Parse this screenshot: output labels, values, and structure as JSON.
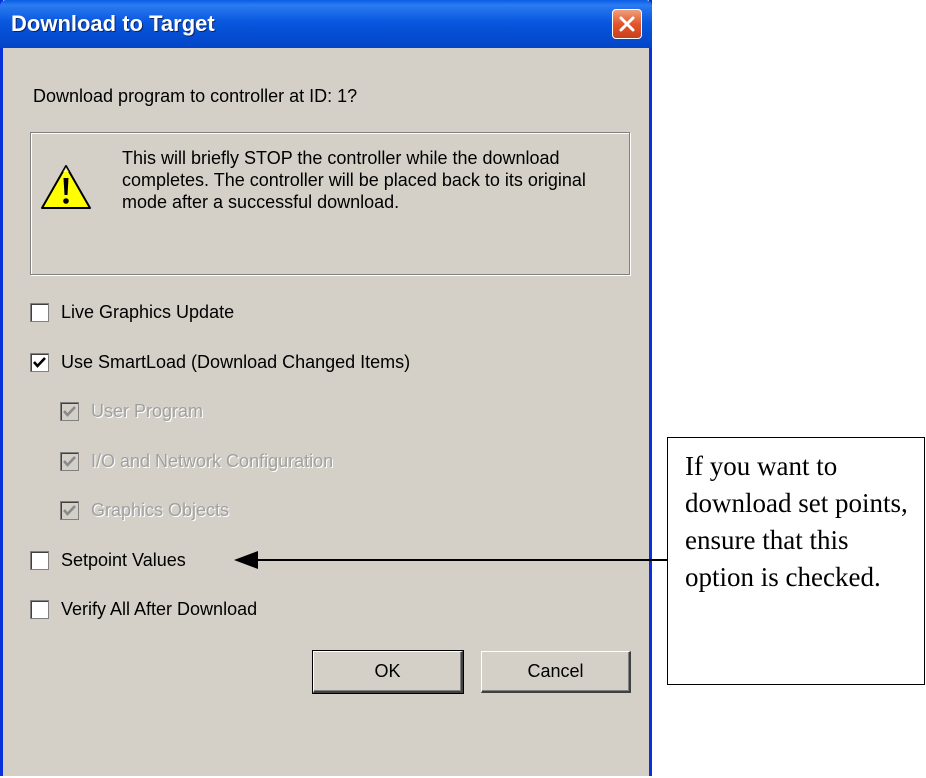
{
  "dialog": {
    "title": "Download to Target",
    "prompt": "Download program to controller at ID: 1?",
    "warning": "This will briefly STOP the controller while the download completes.  The controller will be placed back to its original mode after a successful download.",
    "options": [
      {
        "label": "Live Graphics Update",
        "checked": false,
        "enabled": true
      },
      {
        "label": "Use SmartLoad (Download Changed Items)",
        "checked": true,
        "enabled": true
      },
      {
        "label": "User Program",
        "checked": true,
        "enabled": false
      },
      {
        "label": "I/O and Network Configuration",
        "checked": true,
        "enabled": false
      },
      {
        "label": "Graphics Objects",
        "checked": true,
        "enabled": false
      },
      {
        "label": "Setpoint Values",
        "checked": false,
        "enabled": true
      },
      {
        "label": "Verify All After Download",
        "checked": false,
        "enabled": true
      }
    ],
    "ok_label": "OK",
    "cancel_label": "Cancel"
  },
  "annotation": {
    "text": "If you want to download set points, ensure that this option is checked."
  },
  "colors": {
    "titlebar": "#0a58e0",
    "dialog_bg": "#d4d0c8",
    "close_button": "#e2552c",
    "warning_icon": "#ffff00"
  },
  "icons": {
    "close": "close-icon",
    "warning": "warning-icon",
    "checkmark": "checkmark-icon",
    "arrow": "arrow-left-icon"
  }
}
